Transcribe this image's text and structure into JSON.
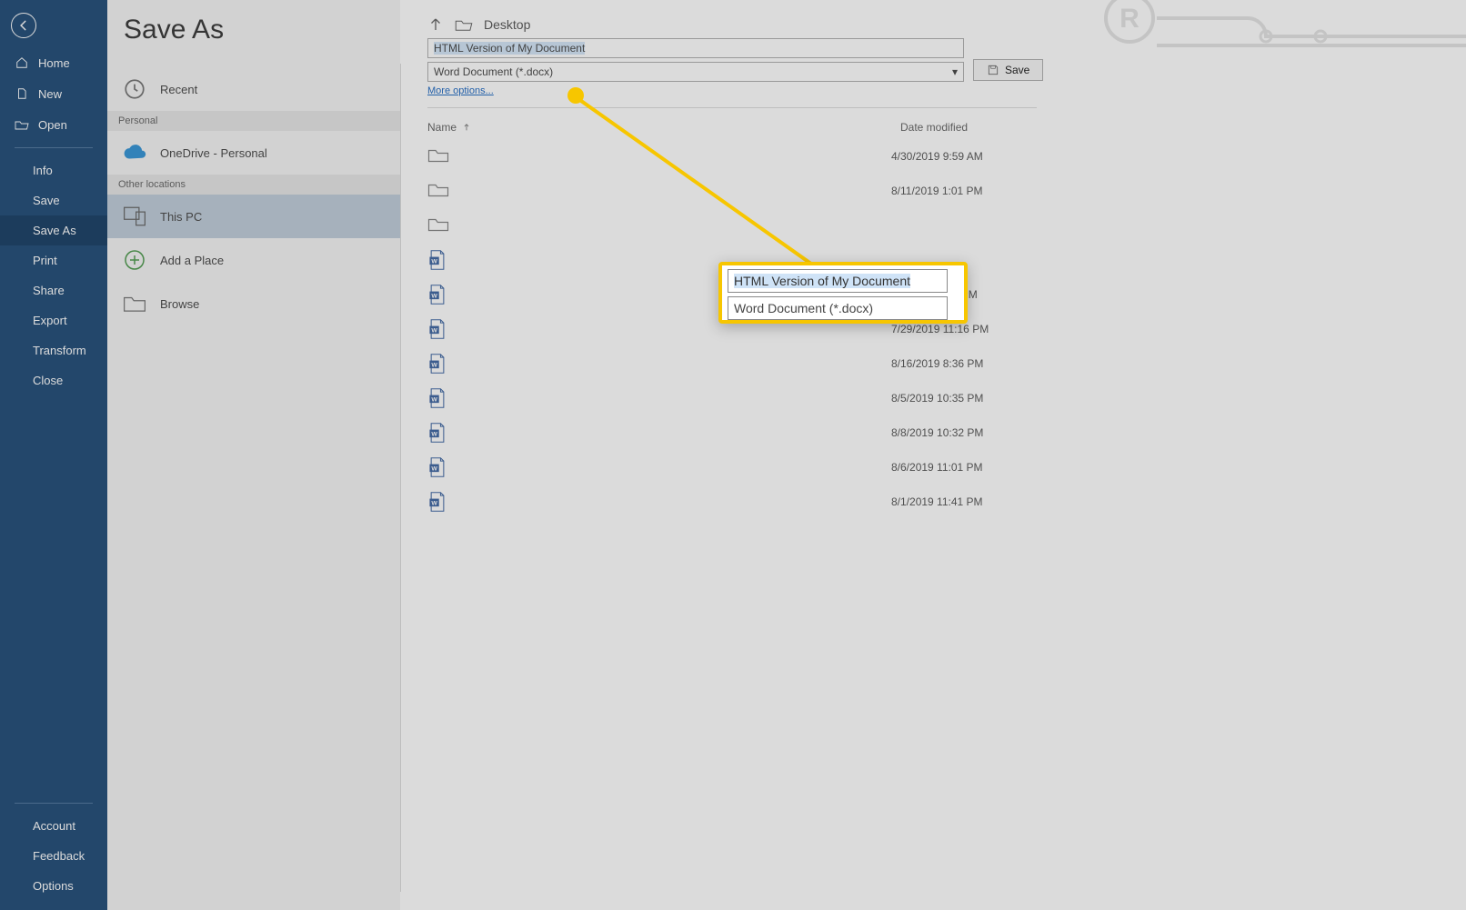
{
  "nav": {
    "top": [
      {
        "label": "Home",
        "icon": "home"
      },
      {
        "label": "New",
        "icon": "file"
      },
      {
        "label": "Open",
        "icon": "folder-open"
      }
    ],
    "file": [
      {
        "label": "Info"
      },
      {
        "label": "Save"
      },
      {
        "label": "Save As",
        "active": true
      },
      {
        "label": "Print"
      },
      {
        "label": "Share"
      },
      {
        "label": "Export"
      },
      {
        "label": "Transform"
      },
      {
        "label": "Close"
      }
    ],
    "bottom": [
      {
        "label": "Account"
      },
      {
        "label": "Feedback"
      },
      {
        "label": "Options"
      }
    ]
  },
  "title": "Save As",
  "mid": {
    "recent": "Recent",
    "personal_hdr": "Personal",
    "onedrive": "OneDrive - Personal",
    "other_hdr": "Other locations",
    "thispc": "This PC",
    "addplace": "Add a Place",
    "browse": "Browse"
  },
  "right": {
    "breadcrumb": "Desktop",
    "filename": "HTML Version of My Document",
    "filetype": "Word Document (*.docx)",
    "save": "Save",
    "more": "More options...",
    "cols": {
      "name": "Name",
      "date": "Date modified"
    },
    "rows": [
      {
        "kind": "folder",
        "date": "4/30/2019 9:59 AM"
      },
      {
        "kind": "folder",
        "date": "8/11/2019 1:01 PM"
      },
      {
        "kind": "folder",
        "date": ""
      },
      {
        "kind": "word",
        "date": ""
      },
      {
        "kind": "word",
        "date": "8/8/2019 5:03 PM"
      },
      {
        "kind": "word",
        "date": "7/29/2019 11:16 PM"
      },
      {
        "kind": "word",
        "date": "8/16/2019 8:36 PM"
      },
      {
        "kind": "word",
        "date": "8/5/2019 10:35 PM"
      },
      {
        "kind": "word",
        "date": "8/8/2019 10:32 PM"
      },
      {
        "kind": "word",
        "date": "8/6/2019 11:01 PM"
      },
      {
        "kind": "word",
        "date": "8/1/2019 11:41 PM"
      }
    ]
  },
  "callout": {
    "filename": "HTML Version of My Document",
    "filetype_partial": "Word Document (*.docx)"
  }
}
